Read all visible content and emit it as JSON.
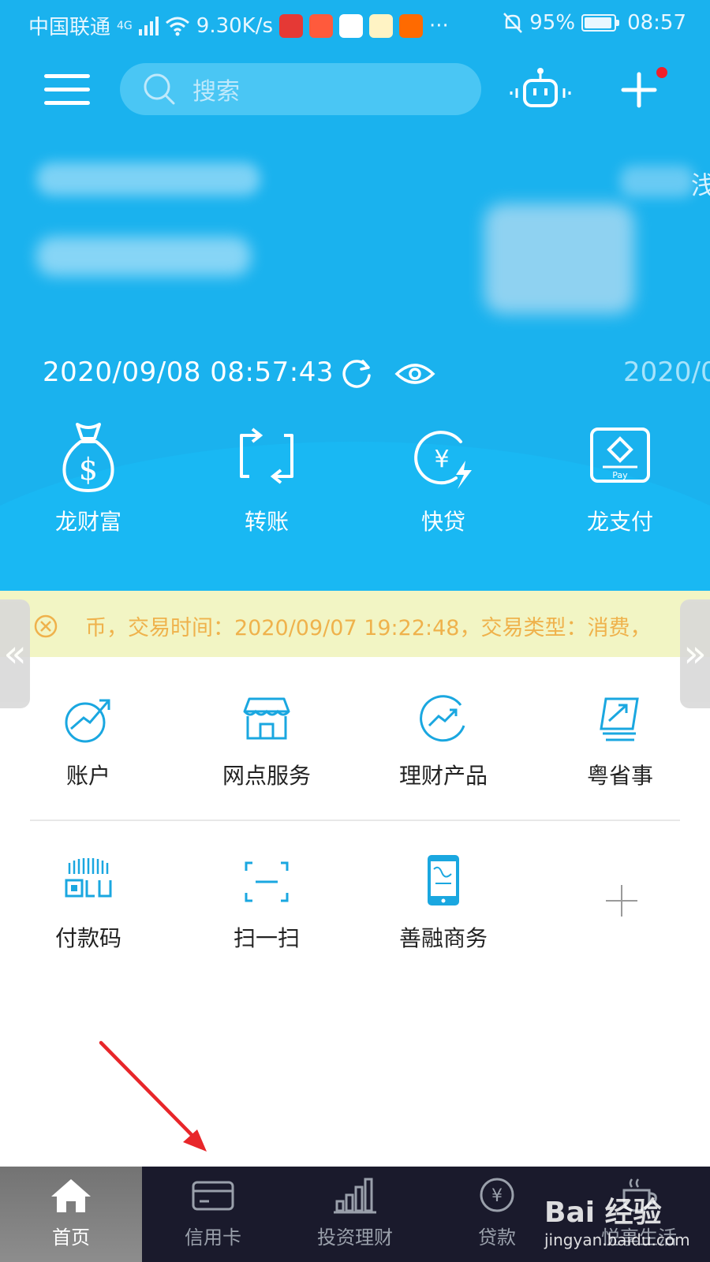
{
  "status_bar": {
    "carrier": "中国联通",
    "network": "4G",
    "speed": "9.30K/s",
    "more": "···",
    "battery": "95%",
    "time": "08:57"
  },
  "header": {
    "search_placeholder": "搜索"
  },
  "banner": {
    "datetime": "2020/09/08 08:57:43",
    "datetime_next": "2020/0",
    "edge_text": "浅"
  },
  "quick_actions": [
    {
      "label": "龙财富",
      "icon": "money-bag-icon"
    },
    {
      "label": "转账",
      "icon": "transfer-icon"
    },
    {
      "label": "快贷",
      "icon": "quick-loan-icon"
    },
    {
      "label": "龙支付",
      "icon": "long-pay-icon"
    }
  ],
  "notice": {
    "text": "币，交易时间：2020/09/07 19:22:48，交易类型：消费，"
  },
  "services": [
    {
      "label": "账户",
      "icon": "account-trend-icon"
    },
    {
      "label": "网点服务",
      "icon": "branch-store-icon"
    },
    {
      "label": "理财产品",
      "icon": "wealth-product-icon"
    },
    {
      "label": "粤省事",
      "icon": "yue-sheng-shi-icon"
    },
    {
      "label": "付款码",
      "icon": "payment-code-icon"
    },
    {
      "label": "扫一扫",
      "icon": "scan-icon"
    },
    {
      "label": "善融商务",
      "icon": "shanrong-phone-icon"
    }
  ],
  "tabbar": {
    "tabs": [
      {
        "label": "首页",
        "icon": "home-icon",
        "active": true
      },
      {
        "label": "信用卡",
        "icon": "credit-card-icon",
        "active": false
      },
      {
        "label": "投资理财",
        "icon": "bar-chart-icon",
        "active": false
      },
      {
        "label": "贷款",
        "icon": "yen-coin-icon",
        "active": false
      },
      {
        "label": "悦享生活",
        "icon": "coffee-cup-icon",
        "active": false
      }
    ]
  },
  "watermark": {
    "brand": "Bai 经验",
    "url": "jingyan.baidu.com"
  },
  "colors": {
    "header_blue": "#1ab2ee",
    "notice_bg": "#f2f5c4",
    "notice_text": "#efb24c",
    "icon_blue": "#1aa7e0",
    "tabbar_bg": "#1a1a2c",
    "annotation_red": "#e8262a"
  }
}
